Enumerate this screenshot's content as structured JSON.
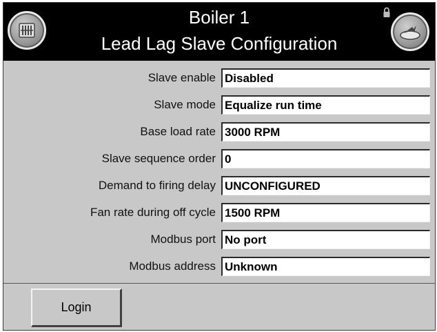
{
  "header": {
    "title_line1": "Boiler 1",
    "title_line2": "Lead Lag Slave Configuration",
    "left_icon": "boiler-panel-icon",
    "right_icon": "back-arrow-icon",
    "lock_icon": "lock-icon"
  },
  "fields": [
    {
      "label": "Slave enable",
      "value": "Disabled"
    },
    {
      "label": "Slave mode",
      "value": "Equalize run time"
    },
    {
      "label": "Base load rate",
      "value": "3000 RPM"
    },
    {
      "label": "Slave sequence order",
      "value": "0"
    },
    {
      "label": "Demand to firing delay",
      "value": "UNCONFIGURED"
    },
    {
      "label": "Fan rate during off cycle",
      "value": "1500 RPM"
    },
    {
      "label": "Modbus port",
      "value": "No port"
    },
    {
      "label": "Modbus address",
      "value": "Unknown"
    }
  ],
  "footer": {
    "login_label": "Login"
  },
  "colors": {
    "header_bg": "#000000",
    "panel_bg": "#c8c8c8",
    "field_bg": "#ffffff"
  }
}
